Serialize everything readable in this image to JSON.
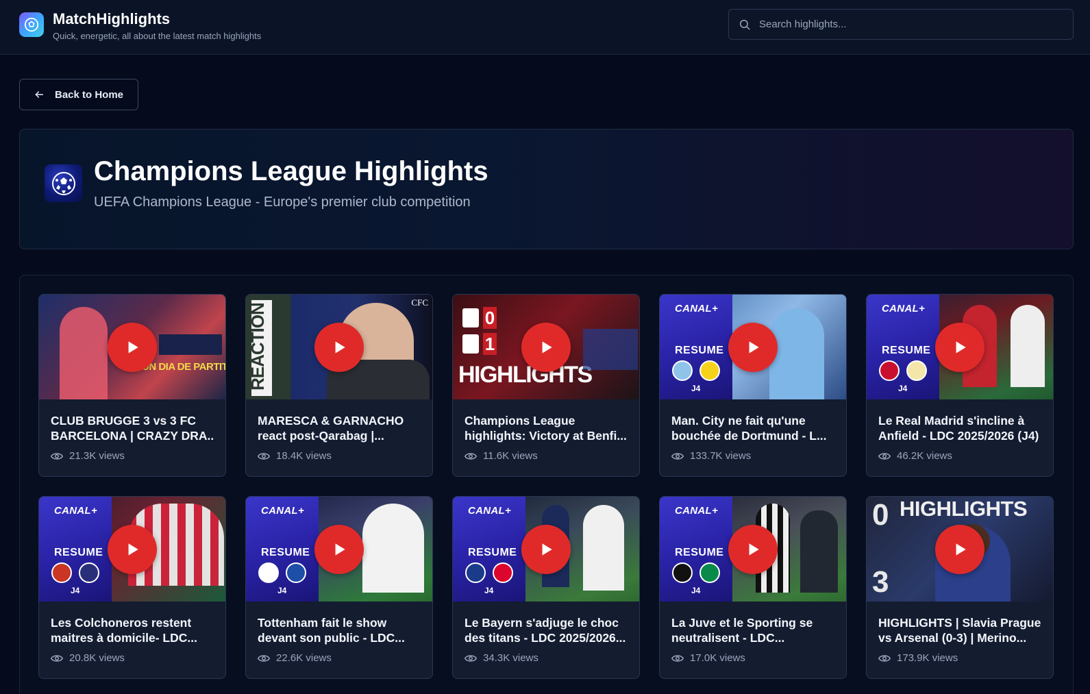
{
  "app": {
    "name": "MatchHighlights",
    "tagline": "Quick, energetic, all about the latest match highlights"
  },
  "search": {
    "placeholder": "Search highlights..."
  },
  "nav": {
    "back_label": "Back to Home"
  },
  "league": {
    "title": "Champions League Highlights",
    "subtitle": "UEFA Champions League - Europe's premier club competition"
  },
  "colors": {
    "background": "#050b1c",
    "card": "#141c30",
    "play_button": "#e02a2a",
    "canal_panel": "#2a23a8"
  },
  "videos": [
    {
      "title_line1": "CLUB BRUGGE 3 vs 3 FC",
      "title_line2": "BARCELONA | CRAZY DRA...",
      "views": "21.3K views",
      "thumb_text": "UN DIA DE PARTIT"
    },
    {
      "title_line1": "MARESCA & GARNACHO",
      "title_line2": "react post-Qarabag |...",
      "views": "18.4K views",
      "thumb_text": "REACTION",
      "thumb_corner": "CFC"
    },
    {
      "title_line1": "Champions League",
      "title_line2": "highlights: Victory at Benfi...",
      "views": "11.6K views",
      "thumb_text": "HIGHLIGHTS",
      "score_top": "0",
      "score_bottom": "1"
    },
    {
      "title_line1": "Man. City ne fait qu'une",
      "title_line2": "bouchée de Dortmund - L...",
      "views": "133.7K views",
      "canal": "CANAL+",
      "resume": "RESUME",
      "matchday": "J4"
    },
    {
      "title_line1": "Le Real Madrid s'incline à",
      "title_line2": "Anfield - LDC 2025/2026 (J4)",
      "views": "46.2K views",
      "canal": "CANAL+",
      "resume": "RESUME",
      "matchday": "J4"
    },
    {
      "title_line1": "Les Colchoneros restent",
      "title_line2": "maitres à domicile- LDC...",
      "views": "20.8K views",
      "canal": "CANAL+",
      "resume": "RESUME",
      "matchday": "J4"
    },
    {
      "title_line1": "Tottenham fait le show",
      "title_line2": "devant son public - LDC...",
      "views": "22.6K views",
      "canal": "CANAL+",
      "resume": "RESUME",
      "matchday": "J4"
    },
    {
      "title_line1": "Le Bayern s'adjuge le choc",
      "title_line2": "des titans - LDC 2025/2026...",
      "views": "34.3K views",
      "canal": "CANAL+",
      "resume": "RESUME",
      "matchday": "J4"
    },
    {
      "title_line1": "La Juve et le Sporting se",
      "title_line2": "neutralisent - LDC...",
      "views": "17.0K views",
      "canal": "CANAL+",
      "resume": "RESUME",
      "matchday": "J4"
    },
    {
      "title_line1": "HIGHLIGHTS | Slavia Prague",
      "title_line2": "vs Arsenal (0-3) | Merino...",
      "views": "173.9K views",
      "thumb_text": "HIGHLIGHTS",
      "score_top": "0",
      "score_bottom": "3"
    }
  ]
}
